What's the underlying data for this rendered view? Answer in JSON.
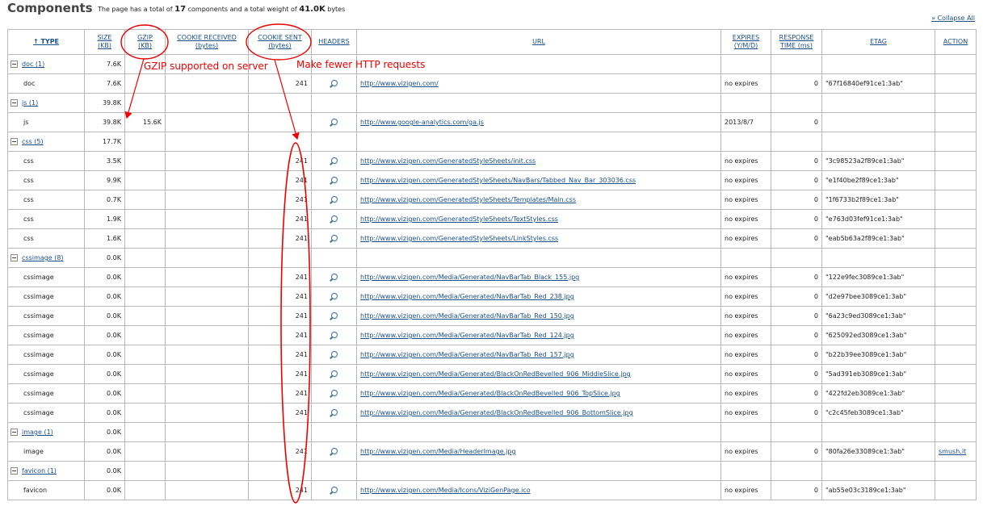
{
  "header": {
    "title": "Components",
    "summary_prefix": "The page has a total of",
    "component_count": "17",
    "summary_mid": "components and a total weight of",
    "total_weight": "41.0K",
    "summary_suffix": "bytes",
    "collapse_all": "» Collapse All"
  },
  "columns": [
    {
      "label": "↑ TYPE",
      "line2": ""
    },
    {
      "label": "SIZE",
      "line2": "(KB)"
    },
    {
      "label": "GZIP",
      "line2": "(KB)"
    },
    {
      "label": "COOKIE RECEIVED",
      "line2": "(bytes)"
    },
    {
      "label": "COOKIE SENT",
      "line2": "(bytes)"
    },
    {
      "label": "HEADERS",
      "line2": ""
    },
    {
      "label": "URL",
      "line2": ""
    },
    {
      "label": "EXPIRES",
      "line2": "(Y/M/D)"
    },
    {
      "label": "RESPONSE",
      "line2": "TIME (ms)"
    },
    {
      "label": "ETAG",
      "line2": ""
    },
    {
      "label": "ACTION",
      "line2": ""
    }
  ],
  "rows": [
    {
      "kind": "group",
      "name": "doc (1)",
      "size": "7.6K"
    },
    {
      "kind": "item",
      "type": "doc",
      "size": "7.6K",
      "gzip": "",
      "cookie_received": "",
      "cookie_sent": "241",
      "headers": true,
      "url": "http://www.vizigen.com/",
      "expires": "no expires",
      "response": "0",
      "etag": "\"67f16840ef91ce1:3ab\"",
      "action": ""
    },
    {
      "kind": "group",
      "name": "js (1)",
      "size": "39.8K"
    },
    {
      "kind": "item",
      "type": "js",
      "size": "39.8K",
      "gzip": "15.6K",
      "cookie_received": "",
      "cookie_sent": "",
      "headers": true,
      "url": "http://www.google-analytics.com/ga.js",
      "expires": "2013/8/7",
      "response": "0",
      "etag": "",
      "action": ""
    },
    {
      "kind": "group",
      "name": "css (5)",
      "size": "17.7K"
    },
    {
      "kind": "item",
      "type": "css",
      "size": "3.5K",
      "gzip": "",
      "cookie_received": "",
      "cookie_sent": "241",
      "headers": true,
      "url": "http://www.vizigen.com/GeneratedStyleSheets/init.css",
      "expires": "no expires",
      "response": "0",
      "etag": "\"3c98523a2f89ce1:3ab\"",
      "action": ""
    },
    {
      "kind": "item",
      "type": "css",
      "size": "9.9K",
      "gzip": "",
      "cookie_received": "",
      "cookie_sent": "241",
      "headers": true,
      "url": "http://www.vizigen.com/GeneratedStyleSheets/NavBars/Tabbed_Nav_Bar_303036.css",
      "expires": "no expires",
      "response": "0",
      "etag": "\"e1f40be2f89ce1:3ab\"",
      "action": ""
    },
    {
      "kind": "item",
      "type": "css",
      "size": "0.7K",
      "gzip": "",
      "cookie_received": "",
      "cookie_sent": "241",
      "headers": true,
      "url": "http://www.vizigen.com/GeneratedStyleSheets/Templates/Main.css",
      "expires": "no expires",
      "response": "0",
      "etag": "\"1f6733b2f89ce1:3ab\"",
      "action": ""
    },
    {
      "kind": "item",
      "type": "css",
      "size": "1.9K",
      "gzip": "",
      "cookie_received": "",
      "cookie_sent": "241",
      "headers": true,
      "url": "http://www.vizigen.com/GeneratedStyleSheets/TextStyles.css",
      "expires": "no expires",
      "response": "0",
      "etag": "\"e763d03fef91ce1:3ab\"",
      "action": ""
    },
    {
      "kind": "item",
      "type": "css",
      "size": "1.6K",
      "gzip": "",
      "cookie_received": "",
      "cookie_sent": "241",
      "headers": true,
      "url": "http://www.vizigen.com/GeneratedStyleSheets/LinkStyles.css",
      "expires": "no expires",
      "response": "0",
      "etag": "\"eab5b63a2f89ce1:3ab\"",
      "action": ""
    },
    {
      "kind": "group",
      "name": "cssimage (8)",
      "size": "0.0K"
    },
    {
      "kind": "item",
      "type": "cssimage",
      "size": "0.0K",
      "gzip": "",
      "cookie_received": "",
      "cookie_sent": "241",
      "headers": true,
      "url": "http://www.vizigen.com/Media/Generated/NavBarTab_Black_155.jpg",
      "expires": "no expires",
      "response": "0",
      "etag": "\"122e9fec3089ce1:3ab\"",
      "action": ""
    },
    {
      "kind": "item",
      "type": "cssimage",
      "size": "0.0K",
      "gzip": "",
      "cookie_received": "",
      "cookie_sent": "241",
      "headers": true,
      "url": "http://www.vizigen.com/Media/Generated/NavBarTab_Red_238.jpg",
      "expires": "no expires",
      "response": "0",
      "etag": "\"d2e97bee3089ce1:3ab\"",
      "action": ""
    },
    {
      "kind": "item",
      "type": "cssimage",
      "size": "0.0K",
      "gzip": "",
      "cookie_received": "",
      "cookie_sent": "241",
      "headers": true,
      "url": "http://www.vizigen.com/Media/Generated/NavBarTab_Red_150.jpg",
      "expires": "no expires",
      "response": "0",
      "etag": "\"6a23c9ed3089ce1:3ab\"",
      "action": ""
    },
    {
      "kind": "item",
      "type": "cssimage",
      "size": "0.0K",
      "gzip": "",
      "cookie_received": "",
      "cookie_sent": "241",
      "headers": true,
      "url": "http://www.vizigen.com/Media/Generated/NavBarTab_Red_124.jpg",
      "expires": "no expires",
      "response": "0",
      "etag": "\"625092ed3089ce1:3ab\"",
      "action": ""
    },
    {
      "kind": "item",
      "type": "cssimage",
      "size": "0.0K",
      "gzip": "",
      "cookie_received": "",
      "cookie_sent": "241",
      "headers": true,
      "url": "http://www.vizigen.com/Media/Generated/NavBarTab_Red_157.jpg",
      "expires": "no expires",
      "response": "0",
      "etag": "\"b22b39ee3089ce1:3ab\"",
      "action": ""
    },
    {
      "kind": "item",
      "type": "cssimage",
      "size": "0.0K",
      "gzip": "",
      "cookie_received": "",
      "cookie_sent": "241",
      "headers": true,
      "url": "http://www.vizigen.com/Media/Generated/BlackOnRedBevelled_906_MiddleSlice.jpg",
      "expires": "no expires",
      "response": "0",
      "etag": "\"5ad391eb3089ce1:3ab\"",
      "action": ""
    },
    {
      "kind": "item",
      "type": "cssimage",
      "size": "0.0K",
      "gzip": "",
      "cookie_received": "",
      "cookie_sent": "241",
      "headers": true,
      "url": "http://www.vizigen.com/Media/Generated/BlackOnRedBevelled_906_TopSlice.jpg",
      "expires": "no expires",
      "response": "0",
      "etag": "\"422fd2eb3089ce1:3ab\"",
      "action": ""
    },
    {
      "kind": "item",
      "type": "cssimage",
      "size": "0.0K",
      "gzip": "",
      "cookie_received": "",
      "cookie_sent": "241",
      "headers": true,
      "url": "http://www.vizigen.com/Media/Generated/BlackOnRedBevelled_906_BottomSlice.jpg",
      "expires": "no expires",
      "response": "0",
      "etag": "\"c2c45feb3089ce1:3ab\"",
      "action": ""
    },
    {
      "kind": "group",
      "name": "image (1)",
      "size": "0.0K"
    },
    {
      "kind": "item",
      "type": "image",
      "size": "0.0K",
      "gzip": "",
      "cookie_received": "",
      "cookie_sent": "241",
      "headers": true,
      "url": "http://www.vizigen.com/Media/HeaderImage.jpg",
      "expires": "no expires",
      "response": "0",
      "etag": "\"80fa26e33089ce1:3ab\"",
      "action": "smush.it"
    },
    {
      "kind": "group",
      "name": "favicon (1)",
      "size": "0.0K"
    },
    {
      "kind": "item",
      "type": "favicon",
      "size": "0.0K",
      "gzip": "",
      "cookie_received": "",
      "cookie_sent": "241",
      "headers": true,
      "url": "http://www.vizigen.com/Media/Icons/ViziGenPage.ico",
      "expires": "no expires",
      "response": "0",
      "etag": "\"ab55e03c3189ce1:3ab\"",
      "action": ""
    }
  ],
  "annotations": {
    "gzip_note": "GZIP supported on server",
    "cookie_note": "Make fewer HTTP requests",
    "color": "#e00000"
  }
}
